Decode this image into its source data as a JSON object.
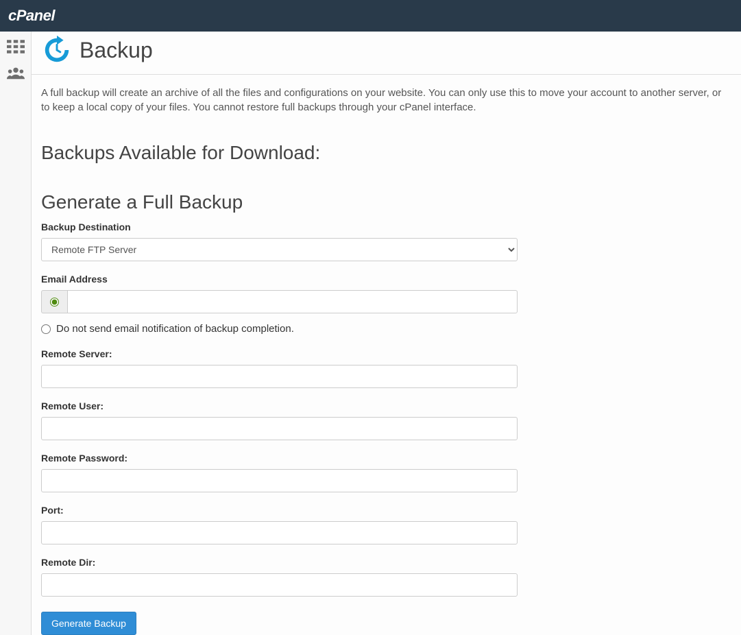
{
  "header": {
    "brand": "cPanel"
  },
  "page": {
    "title": "Backup",
    "description": "A full backup will create an archive of all the files and configurations on your website. You can only use this to move your account to another server, or to keep a local copy of your files. You cannot restore full backups through your cPanel interface."
  },
  "sections": {
    "available_heading": "Backups Available for Download:",
    "generate_heading": "Generate a Full Backup"
  },
  "form": {
    "destination_label": "Backup Destination",
    "destination_value": "Remote FTP Server",
    "email_label": "Email Address",
    "email_value": "",
    "no_email_radio_label": "Do not send email notification of backup completion.",
    "remote_server_label": "Remote Server:",
    "remote_server_value": "",
    "remote_user_label": "Remote User:",
    "remote_user_value": "",
    "remote_password_label": "Remote Password:",
    "remote_password_value": "",
    "port_label": "Port:",
    "port_value": "",
    "remote_dir_label": "Remote Dir:",
    "remote_dir_value": "",
    "submit_label": "Generate Backup"
  }
}
